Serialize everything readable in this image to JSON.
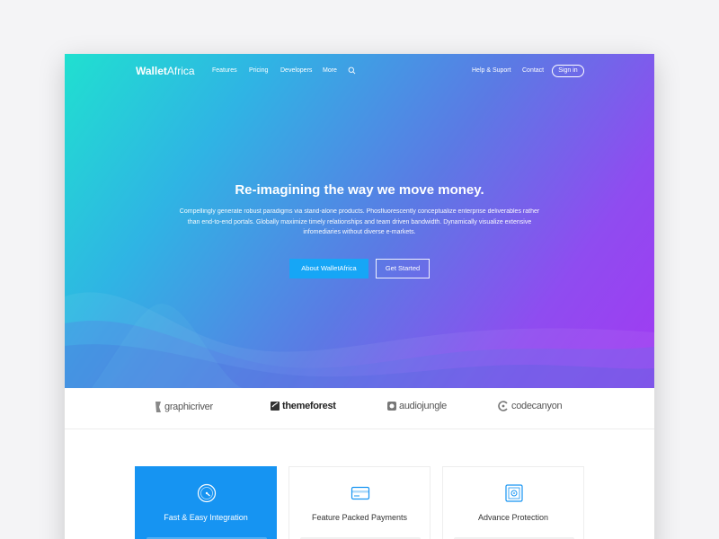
{
  "brand": {
    "bold": "Wallet",
    "light": "Africa"
  },
  "nav": {
    "links": [
      "Features",
      "Pricing",
      "Developers",
      "More"
    ],
    "right": [
      "Help & Suport",
      "Contact"
    ],
    "signin": "Sign in"
  },
  "hero": {
    "headline": "Re-imagining the way we move money.",
    "body": "Compellingly generate robust paradigms via stand-alone products. Phosfluorescently conceptualize enterprise deliverables rather than end-to-end portals. Globally maximize timely relationships and team driven bandwidth. Dynamically visualize extensive infomediaries without diverse e-markets.",
    "primary_button": "About WalletAfrica",
    "secondary_button": "Get Started"
  },
  "partners": [
    "graphicriver",
    "themeforest",
    "audiojungle",
    "codecanyon"
  ],
  "features": [
    {
      "title": "Fast & Easy Integration",
      "icon": "speedometer-icon"
    },
    {
      "title": "Feature Packed Payments",
      "icon": "credit-card-icon"
    },
    {
      "title": "Advance Protection",
      "icon": "safe-icon"
    }
  ],
  "colors": {
    "gradient_start": "#20e0d0",
    "gradient_end": "#a13af2",
    "primary": "#1694f2"
  }
}
